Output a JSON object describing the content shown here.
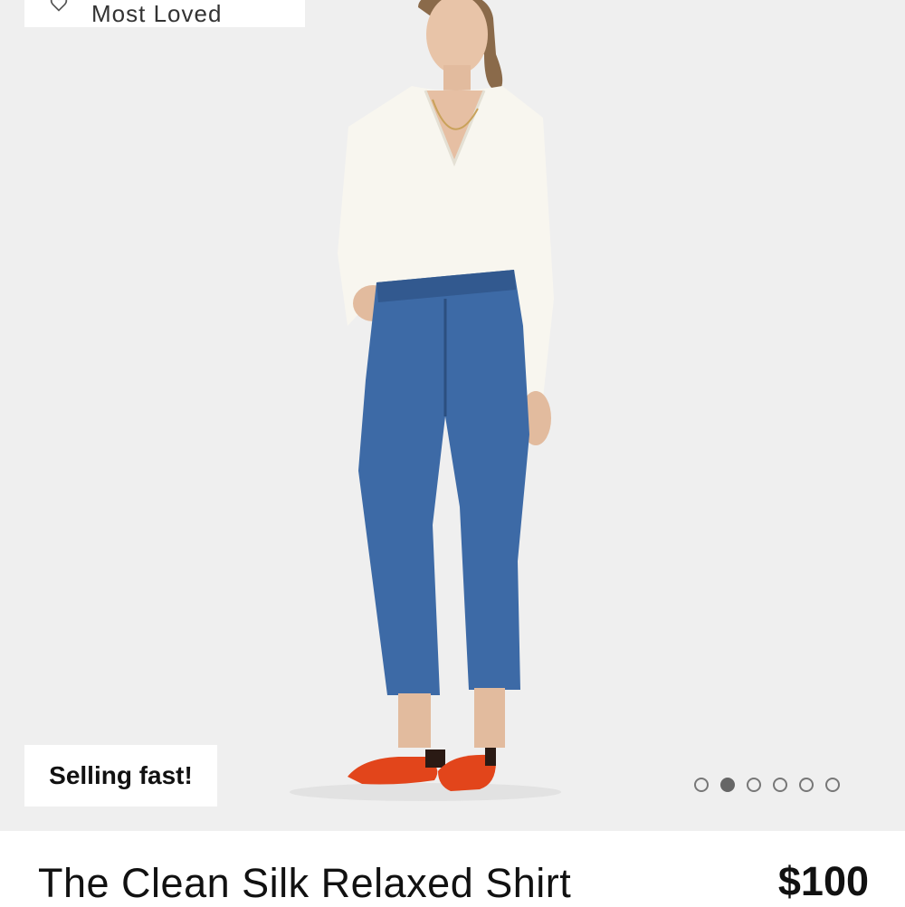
{
  "badges": {
    "top": "Most Loved",
    "selling": "Selling fast!"
  },
  "carousel": {
    "count": 6,
    "active_index": 1
  },
  "product": {
    "title": "The Clean Silk Relaxed Shirt",
    "price": "$100"
  },
  "colors": {
    "image_bg": "#efefef",
    "shirt": "#f8f6ef",
    "denim": "#3d6aa6",
    "shoes": "#e2451b"
  },
  "icons": {
    "top_badge": "heart-icon"
  }
}
